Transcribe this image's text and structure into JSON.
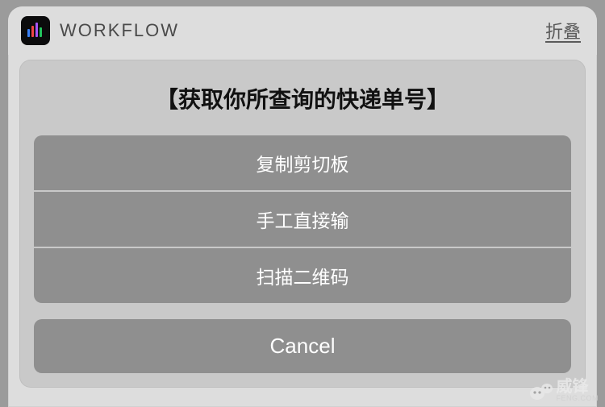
{
  "header": {
    "app_name": "WORKFLOW",
    "collapse_label": "折叠"
  },
  "prompt": {
    "title": "【获取你所查询的快递单号】",
    "options": [
      {
        "label": "复制剪切板"
      },
      {
        "label": "手工直接输"
      },
      {
        "label": "扫描二维码"
      }
    ],
    "cancel_label": "Cancel"
  },
  "watermark": {
    "brand": "威锋",
    "domain": "FENG.COM"
  },
  "colors": {
    "card_bg": "#dddddd",
    "content_bg": "#c9c9c9",
    "button_bg": "#8f8f8f",
    "button_text": "#ffffff"
  }
}
